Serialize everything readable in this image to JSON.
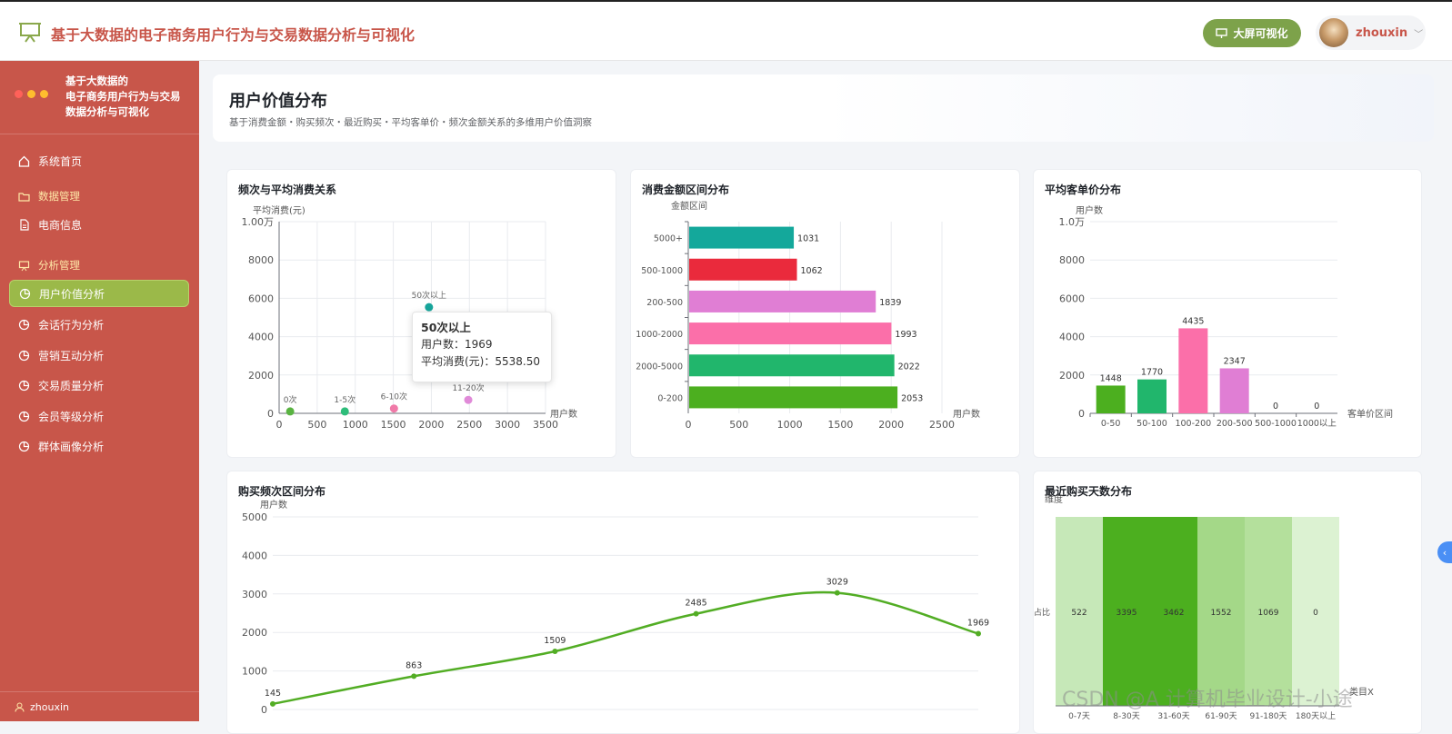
{
  "app": {
    "title": "基于大数据的电子商务用户行为与交易数据分析与可视化",
    "bigscreen_label": "大屏可视化",
    "user": "zhouxin"
  },
  "sidebar": {
    "title_lines": [
      "基于大数据的",
      "电子商务用户行为与交易",
      "数据分析与可视化"
    ],
    "home": "系统首页",
    "group_data": "数据管理",
    "ecommerce": "电商信息",
    "group_analysis": "分析管理",
    "items": [
      "用户价值分析",
      "会话行为分析",
      "营销互动分析",
      "交易质量分析",
      "会员等级分析",
      "群体画像分析"
    ],
    "bottom_user": "zhouxin"
  },
  "page": {
    "title": "用户价值分布",
    "subtitle": "基于消费金额・购买频次・最近购买・平均客单价・频次金额关系的多维用户价值洞察"
  },
  "colors": {
    "brand": "#c8564a",
    "active": "#9bb949"
  },
  "watermark": "CSDN @A 计算机毕业设计-小途",
  "tooltip": {
    "title": "50次以上",
    "line1": "用户数：1969",
    "line2": "平均消费(元)：5538.50"
  },
  "chart_data": [
    {
      "id": "freq_avg",
      "type": "scatter",
      "title": "频次与平均消费关系",
      "ylabel": "平均消费(元)",
      "xlabel": "用户数",
      "xlim": [
        0,
        3500
      ],
      "ylim": [
        0,
        10000
      ],
      "xticks": [
        "0",
        "500",
        "1000",
        "1500",
        "2000",
        "2500",
        "3000",
        "3500"
      ],
      "yticks": [
        "0",
        "2000",
        "4000",
        "6000",
        "8000",
        "1.00万"
      ],
      "points": [
        {
          "label": "0次",
          "x": 145,
          "y": 100,
          "color": "#59b341"
        },
        {
          "label": "1-5次",
          "x": 863,
          "y": 100,
          "color": "#2ebd7a"
        },
        {
          "label": "6-10次",
          "x": 1509,
          "y": 250,
          "color": "#f07aa8"
        },
        {
          "label": "11-20次",
          "x": 2485,
          "y": 700,
          "color": "#e08ad8"
        },
        {
          "label": "",
          "x": 3029,
          "y": 2100,
          "color": "#e8334a"
        },
        {
          "label": "50次以上",
          "x": 1969,
          "y": 5538.5,
          "color": "#17a59b"
        }
      ]
    },
    {
      "id": "amount_range",
      "type": "bar",
      "orientation": "horizontal",
      "title": "消费金额区间分布",
      "ylabel": "金额区间",
      "xlabel": "用户数",
      "xlim": [
        0,
        2500
      ],
      "xticks": [
        "0",
        "500",
        "1000",
        "1500",
        "2000",
        "2500"
      ],
      "categories": [
        "5000+",
        "500-1000",
        "200-500",
        "1000-2000",
        "2000-5000",
        "0-200"
      ],
      "values": [
        1031,
        1062,
        1839,
        1993,
        2022,
        2053
      ],
      "colors": [
        "#14a89b",
        "#ea2a3c",
        "#e07ed4",
        "#fb6fa9",
        "#21b66c",
        "#4caf1f"
      ]
    },
    {
      "id": "avg_order",
      "type": "bar",
      "title": "平均客单价分布",
      "ylabel": "用户数",
      "xlabel": "客单价区间",
      "ylim": [
        0,
        10000
      ],
      "yticks": [
        "0",
        "2000",
        "4000",
        "6000",
        "8000",
        "1.0万"
      ],
      "categories": [
        "0-50",
        "50-100",
        "100-200",
        "200-500",
        "500-1000",
        "1000以上"
      ],
      "values": [
        1448,
        1770,
        4435,
        2347,
        0,
        0
      ],
      "colors": [
        "#4caf1f",
        "#21b66c",
        "#fb6fa9",
        "#e07ed4",
        "#ea2a3c",
        "#14a89b"
      ]
    },
    {
      "id": "freq_range",
      "type": "line",
      "title": "购买频次区间分布",
      "ylabel": "用户数",
      "ylim": [
        0,
        5000
      ],
      "yticks": [
        "0",
        "1000",
        "2000",
        "3000",
        "4000",
        "5000"
      ],
      "values": [
        145,
        863,
        1509,
        2485,
        3029,
        1969
      ],
      "color": "#52ad24"
    },
    {
      "id": "recency",
      "type": "heatmap",
      "title": "最近购买天数分布",
      "ylabel": "维度",
      "row_label": "占比",
      "xlabel": "类目X",
      "categories": [
        "0-7天",
        "8-30天",
        "31-60天",
        "61-90天",
        "91-180天",
        "180天以上"
      ],
      "values": [
        522,
        3395,
        3462,
        1552,
        1069,
        0
      ],
      "colors": [
        "#c6e8b8",
        "#4caf1f",
        "#4caf1f",
        "#a4d888",
        "#b4e09c",
        "#dcf2d2"
      ]
    }
  ]
}
